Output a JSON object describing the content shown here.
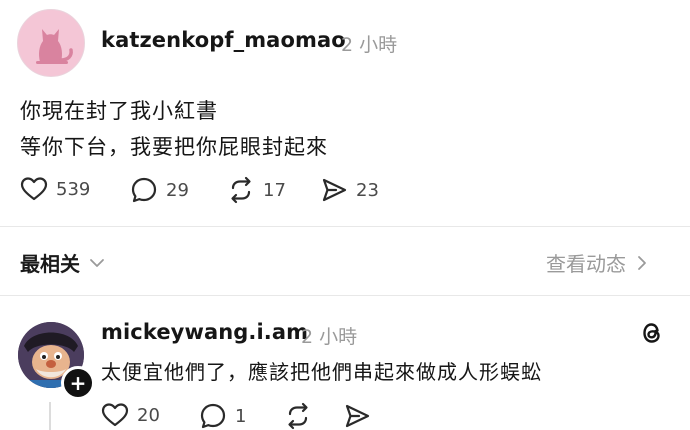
{
  "post": {
    "username": "katzenkopf_maomao",
    "time": "2 小時",
    "lines": [
      "你現在封了我小紅書",
      "等你下台，我要把你屁眼封起來"
    ],
    "actions": {
      "likes": "539",
      "comments": "29",
      "reposts": "17",
      "shares": "23"
    }
  },
  "sort": {
    "label": "最相关",
    "activity": "查看动态"
  },
  "reply": {
    "username": "mickeywang.i.am",
    "time": "2 小時",
    "text": "太便宜他們了，應該把他們串起來做成人形蜈蚣",
    "actions": {
      "likes": "20",
      "comments": "1"
    }
  }
}
